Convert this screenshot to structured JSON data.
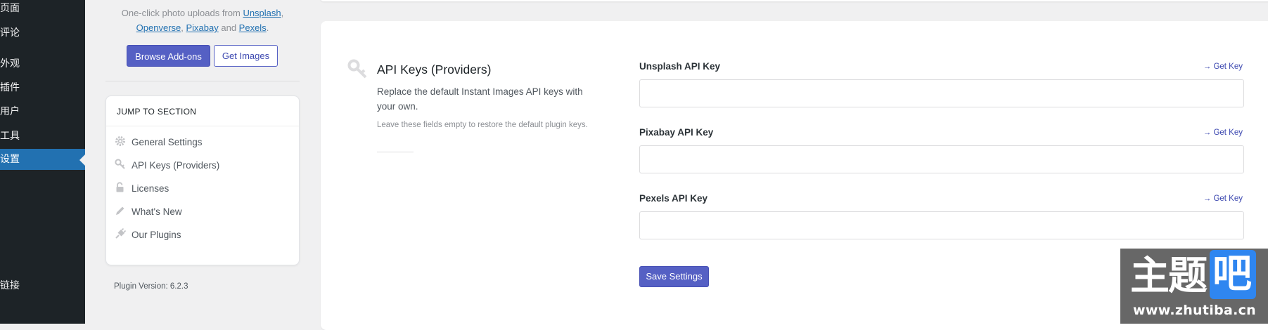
{
  "admin_menu": {
    "items": [
      {
        "label": "页面"
      },
      {
        "label": "评论"
      },
      {
        "label": "外观"
      },
      {
        "label": "插件"
      },
      {
        "label": "用户"
      },
      {
        "label": "工具"
      },
      {
        "label": "设置",
        "active": true
      },
      {
        "label": "链接"
      }
    ],
    "active_color": "#2271b1"
  },
  "intro": {
    "text_prefix": "One-click photo uploads from ",
    "providers": [
      "Unsplash",
      "Openverse",
      "Pixabay",
      "Pexels"
    ],
    "sep_comma": ", ",
    "sep_and": " and ",
    "period": ".",
    "browse_addons_label": "Browse Add-ons",
    "get_images_label": "Get Images"
  },
  "jump_section": {
    "heading": "JUMP TO SECTION",
    "items": [
      {
        "label": "General Settings",
        "icon": "gear-icon"
      },
      {
        "label": "API Keys (Providers)",
        "icon": "key-icon"
      },
      {
        "label": "Licenses",
        "icon": "lock-icon"
      },
      {
        "label": "What's New",
        "icon": "pencil-icon"
      },
      {
        "label": "Our Plugins",
        "icon": "plug-icon"
      }
    ]
  },
  "plugin_version": "Plugin Version: 6.2.3",
  "api_keys": {
    "title": "API Keys (Providers)",
    "description": "Replace the default Instant Images API keys with your own.",
    "note": "Leave these fields empty to restore the default plugin keys.",
    "fields": [
      {
        "label": "Unsplash API Key",
        "link": "→ Get Key",
        "value": "",
        "placeholder": ""
      },
      {
        "label": "Pixabay API Key",
        "link": "→ Get Key",
        "value": "",
        "placeholder": ""
      },
      {
        "label": "Pexels API Key",
        "link": "→ Get Key",
        "value": "",
        "placeholder": ""
      }
    ],
    "save_label": "Save Settings"
  },
  "brand_color": "#5560c4",
  "watermark": {
    "text": "主题",
    "highlight": "吧",
    "url": "www.zhutiba.cn"
  }
}
